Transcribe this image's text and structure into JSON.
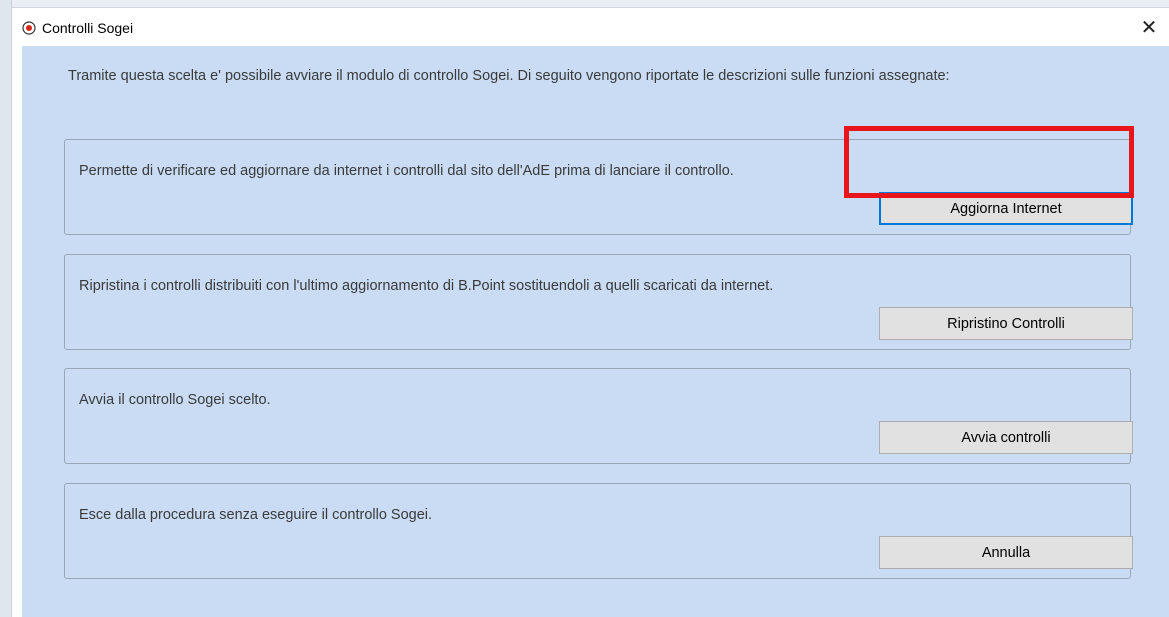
{
  "window": {
    "title": "Controlli Sogei",
    "close_label": "✕",
    "icon": "app-record-icon",
    "close_icon": "close-icon"
  },
  "intro": {
    "text": "Tramite questa scelta e' possibile avviare il modulo di controllo Sogei. Di seguito vengono riportate le descrizioni sulle funzioni assegnate:"
  },
  "groups": [
    {
      "description": "Permette di verificare ed aggiornare da internet i controlli dal sito dell'AdE prima di lanciare il controllo.",
      "button_label": "Aggiorna Internet"
    },
    {
      "description": "Ripristina i controlli distribuiti con l'ultimo aggiornamento di B.Point sostituendoli a quelli scaricati da internet.",
      "button_label": "Ripristino Controlli"
    },
    {
      "description": "Avvia il controllo Sogei scelto.",
      "button_label": "Avvia controlli"
    },
    {
      "description": "Esce dalla procedura senza eseguire il controllo Sogei.",
      "button_label": "Annulla"
    }
  ],
  "colors": {
    "client_background": "#c9dcf4",
    "highlight": "#e8151b",
    "focus_border": "#0078d7"
  }
}
